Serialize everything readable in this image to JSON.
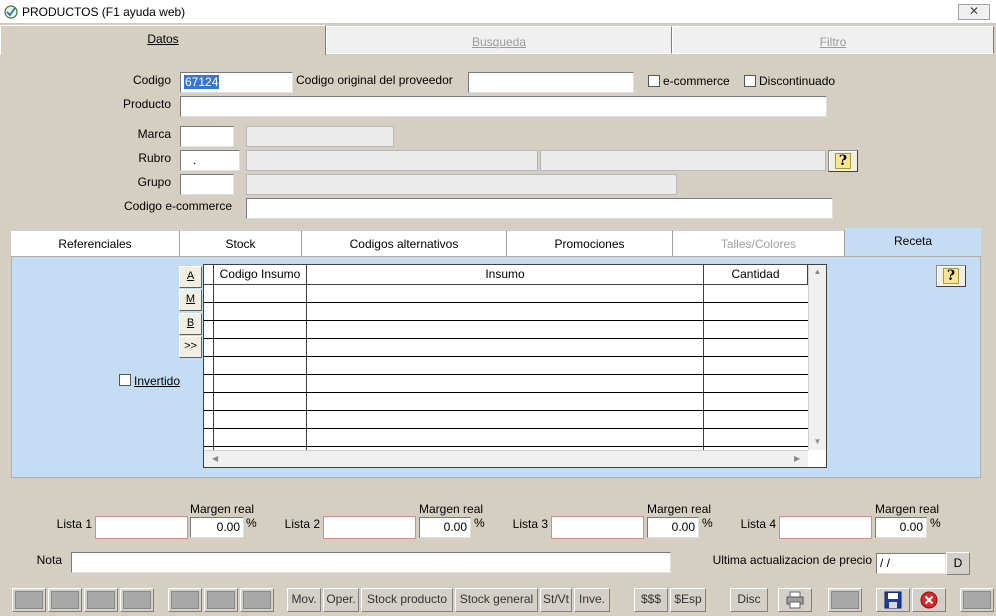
{
  "window": {
    "title": "PRODUCTOS (F1 ayuda web)",
    "close_label": "✕"
  },
  "tabs": [
    {
      "label": "Datos",
      "active": true
    },
    {
      "label": "Busqueda",
      "active": false
    },
    {
      "label": "Filtro",
      "active": false
    }
  ],
  "form": {
    "codigo_label": "Codigo",
    "codigo_value": "67124",
    "codigo_original_label": "Codigo original del proveedor",
    "codigo_original_value": "",
    "ecommerce_label": "e-commerce",
    "discontinuado_label": "Discontinuado",
    "producto_label": "Producto",
    "producto_value": "",
    "marca_label": "Marca",
    "rubro_label": "Rubro",
    "rubro_value": ".",
    "grupo_label": "Grupo",
    "codigo_ecommerce_label": "Codigo e-commerce"
  },
  "subtabs": [
    {
      "label": "Referenciales",
      "state": "normal"
    },
    {
      "label": "Stock",
      "state": "normal"
    },
    {
      "label": "Codigos alternativos",
      "state": "normal"
    },
    {
      "label": "Promociones",
      "state": "normal"
    },
    {
      "label": "Talles/Colores",
      "state": "disabled"
    },
    {
      "label": "Receta",
      "state": "active"
    }
  ],
  "receta": {
    "side_buttons": [
      "A",
      "M",
      "B",
      ">>"
    ],
    "invertido_label": "Invertido",
    "columns": [
      "Codigo Insumo",
      "Insumo",
      "Cantidad"
    ]
  },
  "listas": [
    {
      "label": "Lista 1",
      "margen_label": "Margen real",
      "margen_value": "0.00",
      "pct": "%"
    },
    {
      "label": "Lista 2",
      "margen_label": "Margen real",
      "margen_value": "0.00",
      "pct": "%"
    },
    {
      "label": "Lista 3",
      "margen_label": "Margen real",
      "margen_value": "0.00",
      "pct": "%"
    },
    {
      "label": "Lista 4",
      "margen_label": "Margen real",
      "margen_value": "0.00",
      "pct": "%"
    }
  ],
  "nota_label": "Nota",
  "ultima_label": "Ultima actualizacion de precio",
  "ultima_value": " / /",
  "d_button": "D",
  "toolbar": {
    "mov": "Mov.",
    "oper": "Oper.",
    "stock_producto": "Stock producto",
    "stock_general": "Stock general",
    "stvt": "St/Vt",
    "inve": "Inve.",
    "dolares": "$$$",
    "esp": "$Esp",
    "disc": "Disc"
  },
  "help_glyph": "?",
  "colors": {
    "panel": "#c4dcf4",
    "selection": "#3875d7",
    "close_red": "#d9262a",
    "save_blue": "#1a3ca8"
  }
}
